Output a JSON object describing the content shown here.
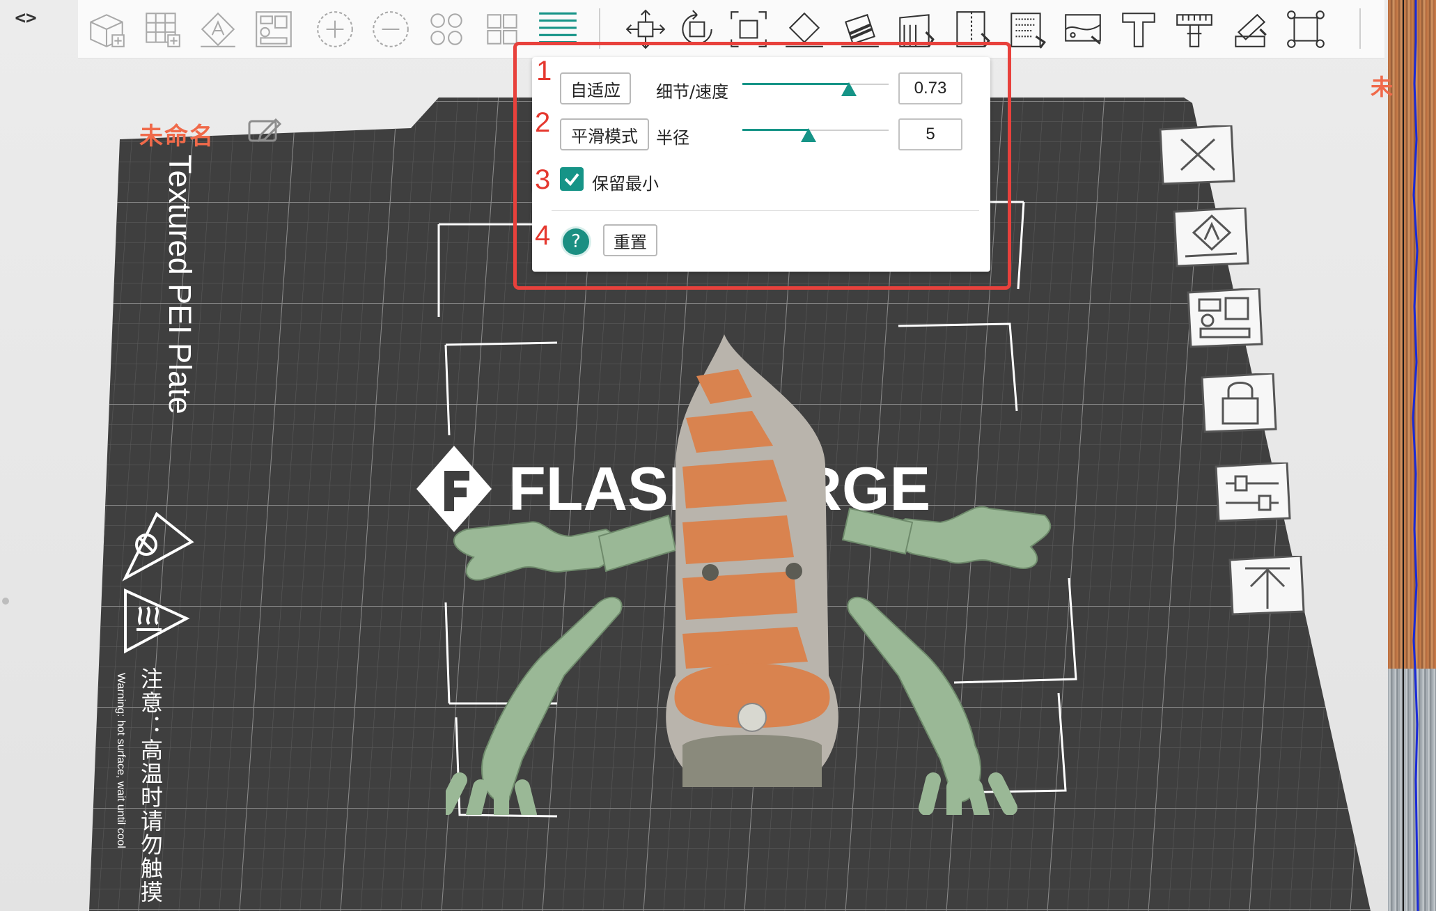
{
  "window": {
    "code_toggle_label": "<>"
  },
  "toolbar": {
    "icons": [
      "add-object-icon",
      "add-plate-icon",
      "auto-orient-icon",
      "arrange-icon",
      "add-instance-icon",
      "remove-instance-icon",
      "split-objects-icon",
      "split-parts-icon",
      "layers-icon",
      "move-icon",
      "rotate-icon",
      "scale-icon",
      "lay-on-face-icon",
      "cut-icon",
      "support-paint-icon",
      "seam-paint-icon",
      "fuzzy-skin-icon",
      "color-paint-icon",
      "text-icon",
      "measure-icon",
      "assembly-icon",
      "place-icon"
    ]
  },
  "plate": {
    "name": "未命名",
    "label": "Textured PEI Plate",
    "warning_cn": "注意：高温时请勿触摸",
    "warning_en": "Warning: hot surface, wait until cool",
    "logo_text": "FLASHFORGE",
    "right_cut_text": "未"
  },
  "side_toolbar": {
    "icons": [
      "delete-all-icon",
      "auto-orient-plate-icon",
      "arrange-plate-icon",
      "lock-plate-icon",
      "plate-settings-icon",
      "move-plate-up-icon"
    ]
  },
  "dialog": {
    "annotations": [
      "1",
      "2",
      "3",
      "4"
    ],
    "adaptive_label": "自适应",
    "detail_label": "细节/速度",
    "detail_value": "0.73",
    "detail_fraction": 0.73,
    "smooth_label": "平滑模式",
    "radius_label": "半径",
    "radius_value": "5",
    "radius_fraction": 0.45,
    "keep_min_label": "保留最小",
    "keep_min_checked": true,
    "help_symbol": "?",
    "reset_label": "重置"
  },
  "colors": {
    "accent": "#169487",
    "highlight": "#e8413c",
    "plate": "#3f3f3f",
    "plate_name": "#f06a4a",
    "model_green": "#9ab896",
    "model_orange": "#d9834f"
  }
}
